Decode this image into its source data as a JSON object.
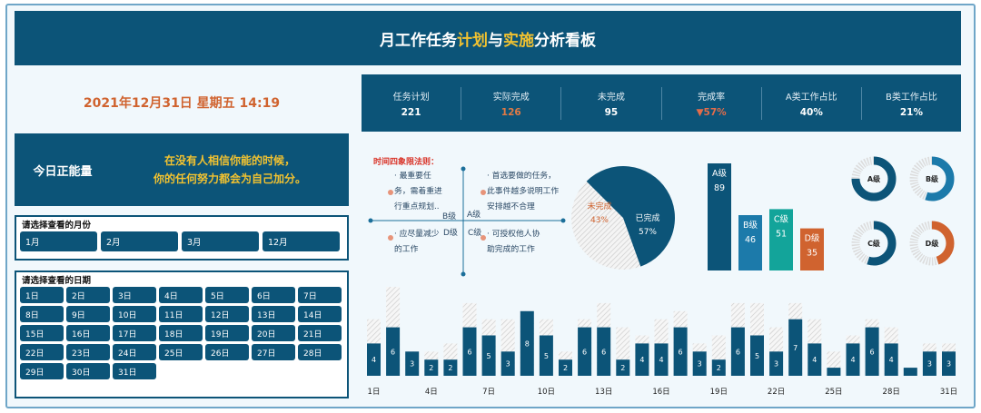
{
  "title": {
    "part1": "月工作任务",
    "part2": "计划",
    "part3": "与",
    "part4": "实施",
    "part5": "分析看板"
  },
  "datetime": "2021年12月31日 星期五 14:19",
  "kpis": [
    {
      "label": "任务计划",
      "value": "221"
    },
    {
      "label": "实际完成",
      "value": "126"
    },
    {
      "label": "未完成",
      "value": "95"
    },
    {
      "label": "完成率",
      "value": "▼57%"
    },
    {
      "label": "A类工作占比",
      "value": "40%"
    },
    {
      "label": "B类工作占比",
      "value": "21%"
    }
  ],
  "motto": {
    "title": "今日正能量",
    "line1": "在没有人相信你能的时候，",
    "line2": "你的任何努力都会为自己加分。"
  },
  "month_panel": {
    "title": "请选择查看的月份",
    "months": [
      "1月",
      "2月",
      "3月",
      "12月"
    ]
  },
  "day_panel": {
    "title": "请选择查看的日期"
  },
  "quadrant": {
    "title": "时间四象限法则：",
    "a_text": [
      "· 首选要做的任务，",
      "此事件越多说明工作",
      "安排越不合理"
    ],
    "b_text": [
      "· 最重要任",
      "务，需着重进",
      "行重点规划.."
    ],
    "c_text": [
      "· 可授权他人协",
      "助完成的工作"
    ],
    "d_text": [
      "· 应尽量减少",
      "的工作"
    ],
    "a_label": "A级",
    "b_label": "B级",
    "c_label": "C级",
    "d_label": "D级"
  },
  "pie": {
    "done_label": "已完成",
    "done_pct": "57%",
    "undone_label": "未完成",
    "undone_pct": "43%"
  },
  "grades": [
    {
      "label": "A级",
      "value": "89",
      "color": "#0c5478"
    },
    {
      "label": "B级",
      "value": "46",
      "color": "#1c7aaa"
    },
    {
      "label": "C级",
      "value": "51",
      "color": "#13a49a"
    },
    {
      "label": "D级",
      "value": "35",
      "color": "#d0632f"
    }
  ],
  "donuts": [
    {
      "label": "A级",
      "color": "#0c5478",
      "fraction": 0.75
    },
    {
      "label": "B级",
      "color": "#1c7aaa",
      "fraction": 0.55
    },
    {
      "label": "C级",
      "color": "#0c5478",
      "fraction": 0.55
    },
    {
      "label": "D级",
      "color": "#d0632f",
      "fraction": 0.45
    }
  ],
  "chart_data": {
    "type": "bar",
    "categories": [
      "1日",
      "2日",
      "3日",
      "4日",
      "5日",
      "6日",
      "7日",
      "8日",
      "9日",
      "10日",
      "11日",
      "12日",
      "13日",
      "14日",
      "15日",
      "16日",
      "17日",
      "18日",
      "19日",
      "20日",
      "21日",
      "22日",
      "23日",
      "24日",
      "25日",
      "26日",
      "27日",
      "28日",
      "29日",
      "30日",
      "31日"
    ],
    "tick_labels": [
      "1日",
      "4日",
      "7日",
      "10日",
      "13日",
      "16日",
      "19日",
      "22日",
      "25日",
      "28日",
      "31日"
    ],
    "series": [
      {
        "values": [
          4,
          6,
          3,
          2,
          2,
          6,
          5,
          3,
          8,
          5,
          2,
          6,
          6,
          2,
          4,
          4,
          6,
          3,
          2,
          6,
          5,
          3,
          7,
          4,
          1,
          4,
          6,
          4,
          1,
          3,
          3
        ]
      },
      {
        "values": [
          7,
          11,
          3,
          3,
          4,
          9,
          7,
          7,
          8,
          7,
          3,
          7,
          9,
          6,
          5,
          7,
          8,
          4,
          5,
          9,
          9,
          6,
          9,
          7,
          3,
          5,
          7,
          6,
          1,
          4,
          4
        ]
      }
    ],
    "colors": {
      "done": "#0c5478",
      "planned": "hatch-gray"
    }
  }
}
